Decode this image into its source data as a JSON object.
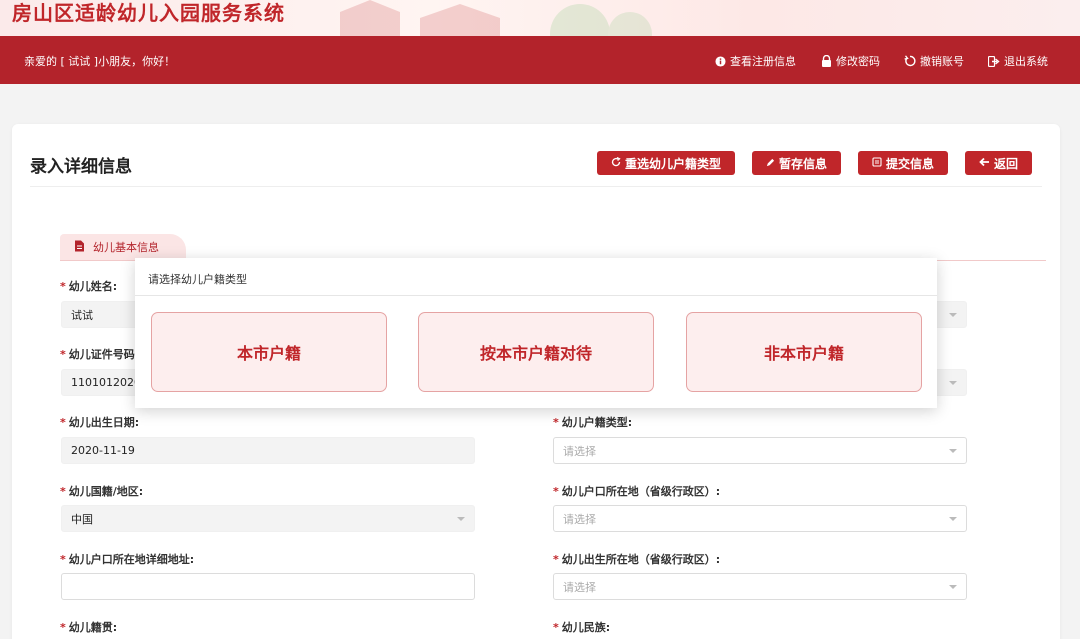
{
  "banner": {
    "title": "房山区适龄幼儿入园服务系统"
  },
  "topbar": {
    "greeting": "亲爱的 [ 试试 ]小朋友，你好！",
    "actions": [
      {
        "label": "查看注册信息",
        "icon": "info-icon"
      },
      {
        "label": "修改密码",
        "icon": "lock-icon"
      },
      {
        "label": "撤销账号",
        "icon": "undo-icon"
      },
      {
        "label": "退出系统",
        "icon": "exit-icon"
      }
    ]
  },
  "page": {
    "title": "录入详细信息",
    "buttons": [
      {
        "label": "重选幼儿户籍类型",
        "icon": "refresh-icon"
      },
      {
        "label": "暂存信息",
        "icon": "pencil-icon"
      },
      {
        "label": "提交信息",
        "icon": "clipboard-icon"
      },
      {
        "label": "返回",
        "icon": "arrow-left-icon"
      }
    ]
  },
  "section": {
    "title": "幼儿基本信息"
  },
  "form": {
    "name_label": "幼儿姓名:",
    "name_value": "试试",
    "id_label": "幼儿证件号码",
    "id_value": "11010120201",
    "birth_label": "幼儿出生日期:",
    "birth_value": "2020-11-19",
    "hukou_type_label": "幼儿户籍类型:",
    "hukou_type_value": "请选择",
    "nationality_label": "幼儿国籍/地区:",
    "nationality_value": "中国",
    "hukou_province_label": "幼儿户口所在地（省级行政区）:",
    "hukou_province_value": "请选择",
    "hukou_address_label": "幼儿户口所在地详细地址:",
    "hukou_address_value": "",
    "birth_province_label": "幼儿出生所在地（省级行政区）:",
    "birth_province_value": "请选择",
    "native_label": "幼儿籍贯:",
    "ethnicity_label": "幼儿民族:",
    "required_mark": "*"
  },
  "modal": {
    "title": "请选择幼儿户籍类型",
    "options": [
      "本市户籍",
      "按本市户籍对待",
      "非本市户籍"
    ]
  },
  "colors": {
    "brand_red": "#b3232b",
    "accent_red": "#c0262a"
  }
}
